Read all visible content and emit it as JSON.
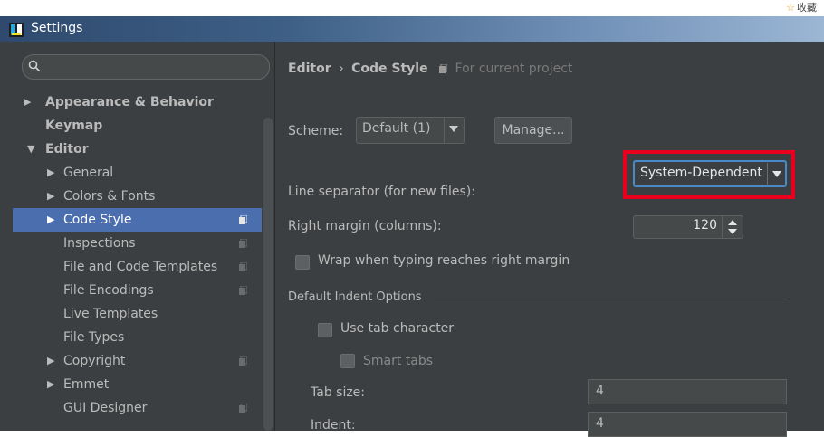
{
  "browser": {
    "favorite_label": "收藏"
  },
  "window": {
    "title": "Settings"
  },
  "search": {
    "placeholder": ""
  },
  "sidebar": {
    "items": [
      {
        "label": "Appearance & Behavior",
        "arrow": "▶",
        "bold": true
      },
      {
        "label": "Keymap",
        "arrow": "",
        "bold": true
      },
      {
        "label": "Editor",
        "arrow": "▼",
        "bold": true
      },
      {
        "label": "General",
        "arrow": "▶"
      },
      {
        "label": "Colors & Fonts",
        "arrow": "▶"
      },
      {
        "label": "Code Style",
        "arrow": "▶",
        "selected": true,
        "project_icon": true
      },
      {
        "label": "Inspections",
        "arrow": "",
        "project_icon": true
      },
      {
        "label": "File and Code Templates",
        "arrow": "",
        "project_icon": true
      },
      {
        "label": "File Encodings",
        "arrow": "",
        "project_icon": true
      },
      {
        "label": "Live Templates",
        "arrow": ""
      },
      {
        "label": "File Types",
        "arrow": ""
      },
      {
        "label": "Copyright",
        "arrow": "▶",
        "project_icon": true
      },
      {
        "label": "Emmet",
        "arrow": "▶"
      },
      {
        "label": "GUI Designer",
        "arrow": "",
        "project_icon": true
      }
    ]
  },
  "breadcrumb": {
    "parent": "Editor",
    "separator": "›",
    "current": "Code Style",
    "note": "For current project"
  },
  "scheme": {
    "label": "Scheme:",
    "value": "Default (1)",
    "manage_label": "Manage..."
  },
  "line_separator": {
    "label": "Line separator (for new files):",
    "value": "System-Dependent"
  },
  "right_margin": {
    "label": "Right margin (columns):",
    "value": "120"
  },
  "wrap": {
    "label": "Wrap when typing reaches right margin",
    "checked": false
  },
  "indent_options": {
    "title": "Default Indent Options",
    "use_tab_label": "Use tab character",
    "smart_tabs_label": "Smart tabs",
    "tab_size_label": "Tab size:",
    "tab_size_value": "4",
    "indent_label": "Indent:",
    "indent_value": "4"
  },
  "colors": {
    "panel_bg": "#3c3f41",
    "selection": "#4b6eaf",
    "text": "#bbbbbb",
    "highlight_box": "#e8001c",
    "focus_border": "#4a88c7"
  },
  "icons": {
    "app": "intellij-app-icon",
    "search": "search-icon",
    "project": "project-scope-icon",
    "dropdown": "chevron-down-icon",
    "spinner": "spinner-arrows-icon"
  }
}
